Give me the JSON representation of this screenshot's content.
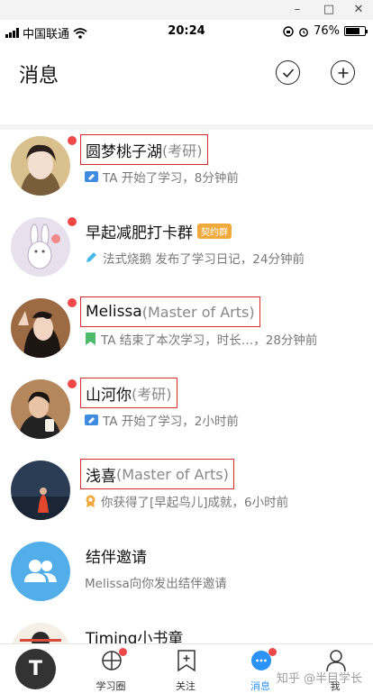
{
  "window": {
    "minimize": "–",
    "maximize": "□",
    "close": "✕"
  },
  "status_bar": {
    "carrier": "中国联通",
    "time": "20:24",
    "battery": "76%"
  },
  "header": {
    "title": "消息"
  },
  "messages": [
    {
      "name": "圆梦桃子湖",
      "tag": "(考研)",
      "badge": "",
      "subtitle": "TA 开始了学习，8分钟前",
      "sub_icon": "blue-card-icon",
      "unread": true,
      "highlighted": true
    },
    {
      "name": "早起减肥打卡群",
      "tag": "",
      "badge": "契约群",
      "subtitle": "法式烧鹅 发布了学习日记，24分钟前",
      "sub_icon": "pencil-icon",
      "unread": true,
      "highlighted": false
    },
    {
      "name": "Melissa",
      "tag": "(Master of Arts)",
      "badge": "",
      "subtitle": "TA 结束了本次学习，时长…，28分钟前",
      "sub_icon": "green-bookmark-icon",
      "unread": true,
      "highlighted": true
    },
    {
      "name": "山河你",
      "tag": "(考研)",
      "badge": "",
      "subtitle": "TA 开始了学习，2小时前",
      "sub_icon": "blue-card-icon",
      "unread": true,
      "highlighted": true
    },
    {
      "name": "浅喜",
      "tag": "(Master of Arts)",
      "badge": "",
      "subtitle": "你获得了[早起鸟儿]成就，6小时前",
      "sub_icon": "achievement-icon",
      "unread": false,
      "highlighted": true
    },
    {
      "name": "结伴邀请",
      "tag": "",
      "badge": "",
      "subtitle": "Melissa向你发出结伴邀请",
      "sub_icon": "",
      "unread": false,
      "highlighted": false
    },
    {
      "name": "Timing小书童",
      "tag": "",
      "badge": "",
      "subtitle": "",
      "sub_icon": "",
      "unread": false,
      "highlighted": false
    }
  ],
  "bottom_nav": {
    "fab_label": "T",
    "items": [
      {
        "label": "学习圈",
        "active": false,
        "dot": true
      },
      {
        "label": "关注",
        "active": false,
        "dot": false
      },
      {
        "label": "消息",
        "active": true,
        "dot": true
      },
      {
        "label": "我",
        "active": false,
        "dot": false
      }
    ]
  },
  "watermark": "知乎 @半目学长",
  "colors": {
    "accent": "#2b93f5",
    "unread_dot": "#f04848",
    "highlight_border": "#d62e2e",
    "badge": "#f0a93c"
  }
}
